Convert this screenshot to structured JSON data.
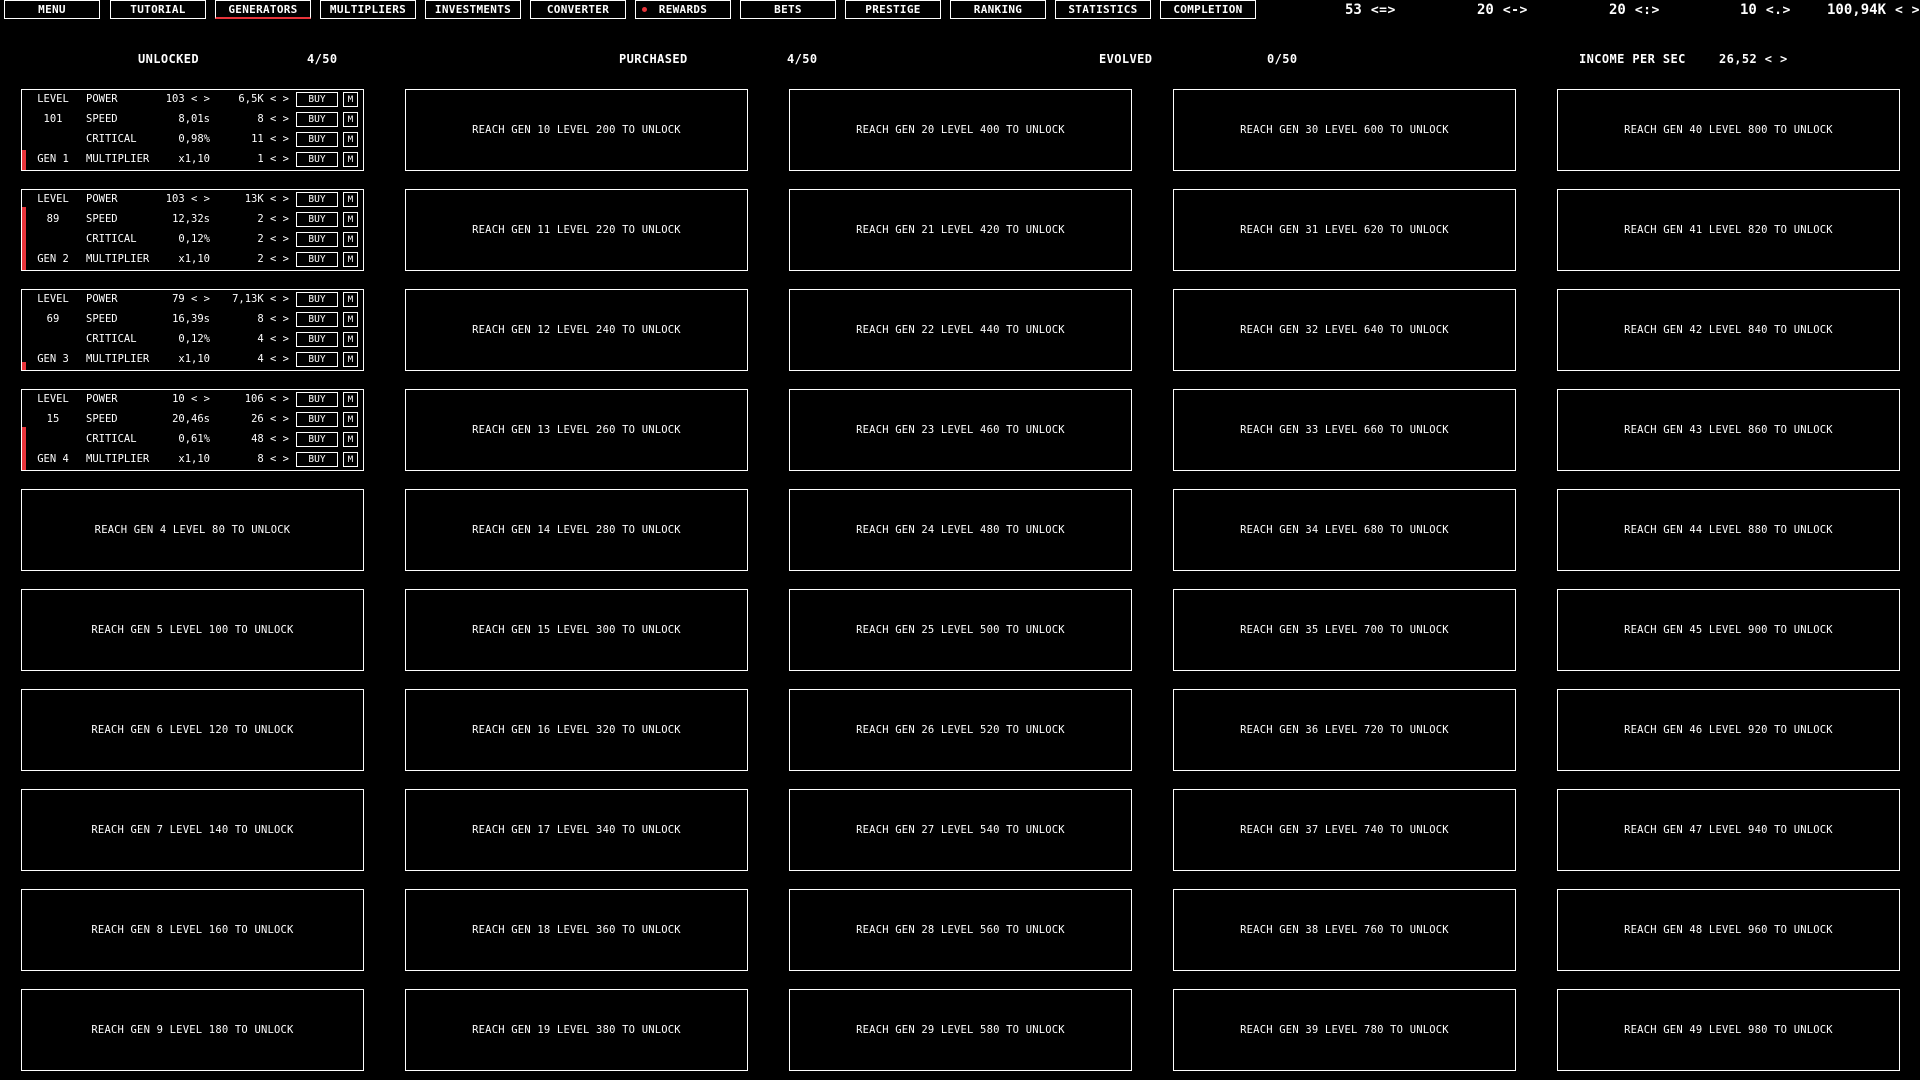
{
  "nav": {
    "tabs": [
      {
        "label": "MENU"
      },
      {
        "label": "TUTORIAL"
      },
      {
        "label": "GENERATORS",
        "active": true
      },
      {
        "label": "MULTIPLIERS"
      },
      {
        "label": "INVESTMENTS"
      },
      {
        "label": "CONVERTER"
      },
      {
        "label": "REWARDS",
        "notification": true
      },
      {
        "label": "BETS"
      },
      {
        "label": "PRESTIGE"
      },
      {
        "label": "RANKING"
      },
      {
        "label": "STATISTICS"
      },
      {
        "label": "COMPLETION"
      }
    ]
  },
  "currencies": [
    {
      "value": "53",
      "symbol": "<=>"
    },
    {
      "value": "20",
      "symbol": "<->"
    },
    {
      "value": "20",
      "symbol": "<:>"
    },
    {
      "value": "10",
      "symbol": "<.>"
    },
    {
      "value": "100,94K",
      "symbol": "< >"
    }
  ],
  "headers": {
    "unlocked": {
      "label": "UNLOCKED",
      "value": "4/50"
    },
    "purchased": {
      "label": "PURCHASED",
      "value": "4/50"
    },
    "evolved": {
      "label": "EVOLVED",
      "value": "0/50"
    },
    "income": {
      "label": "INCOME PER SEC",
      "value": "26,52 < >"
    }
  },
  "labels": {
    "level": "LEVEL",
    "power": "POWER",
    "speed": "SPEED",
    "critical": "CRITICAL",
    "multiplier": "MULTIPLIER",
    "buy": "BUY",
    "max": "M"
  },
  "generators": [
    {
      "level": "101",
      "gen": "GEN 1",
      "progress": 0.25,
      "power": {
        "value": "103 < >",
        "cost": "6,5K < >"
      },
      "speed": {
        "value": "8,01s",
        "cost": "8 < >"
      },
      "critical": {
        "value": "0,98%",
        "cost": "11 < >"
      },
      "multiplier": {
        "value": "x1,10",
        "cost": "1 < >"
      }
    },
    {
      "level": "89",
      "gen": "GEN 2",
      "progress": 0.8,
      "power": {
        "value": "103 < >",
        "cost": "13K < >"
      },
      "speed": {
        "value": "12,32s",
        "cost": "2 < >"
      },
      "critical": {
        "value": "0,12%",
        "cost": "2 < >"
      },
      "multiplier": {
        "value": "x1,10",
        "cost": "2 < >"
      }
    },
    {
      "level": "69",
      "gen": "GEN 3",
      "progress": 0.1,
      "power": {
        "value": "79 < >",
        "cost": "7,13K < >"
      },
      "speed": {
        "value": "16,39s",
        "cost": "8 < >"
      },
      "critical": {
        "value": "0,12%",
        "cost": "4 < >"
      },
      "multiplier": {
        "value": "x1,10",
        "cost": "4 < >"
      }
    },
    {
      "level": "15",
      "gen": "GEN 4",
      "progress": 0.55,
      "power": {
        "value": "10 < >",
        "cost": "106 < >"
      },
      "speed": {
        "value": "20,46s",
        "cost": "26 < >"
      },
      "critical": {
        "value": "0,61%",
        "cost": "48 < >"
      },
      "multiplier": {
        "value": "x1,10",
        "cost": "8 < >"
      }
    }
  ],
  "locked": [
    "REACH GEN 4 LEVEL 80 TO UNLOCK",
    "REACH GEN 5 LEVEL 100 TO UNLOCK",
    "REACH GEN 6 LEVEL 120 TO UNLOCK",
    "REACH GEN 7 LEVEL 140 TO UNLOCK",
    "REACH GEN 8 LEVEL 160 TO UNLOCK",
    "REACH GEN 9 LEVEL 180 TO UNLOCK",
    "REACH GEN 10 LEVEL 200 TO UNLOCK",
    "REACH GEN 11 LEVEL 220 TO UNLOCK",
    "REACH GEN 12 LEVEL 240 TO UNLOCK",
    "REACH GEN 13 LEVEL 260 TO UNLOCK",
    "REACH GEN 14 LEVEL 280 TO UNLOCK",
    "REACH GEN 15 LEVEL 300 TO UNLOCK",
    "REACH GEN 16 LEVEL 320 TO UNLOCK",
    "REACH GEN 17 LEVEL 340 TO UNLOCK",
    "REACH GEN 18 LEVEL 360 TO UNLOCK",
    "REACH GEN 19 LEVEL 380 TO UNLOCK",
    "REACH GEN 20 LEVEL 400 TO UNLOCK",
    "REACH GEN 21 LEVEL 420 TO UNLOCK",
    "REACH GEN 22 LEVEL 440 TO UNLOCK",
    "REACH GEN 23 LEVEL 460 TO UNLOCK",
    "REACH GEN 24 LEVEL 480 TO UNLOCK",
    "REACH GEN 25 LEVEL 500 TO UNLOCK",
    "REACH GEN 26 LEVEL 520 TO UNLOCK",
    "REACH GEN 27 LEVEL 540 TO UNLOCK",
    "REACH GEN 28 LEVEL 560 TO UNLOCK",
    "REACH GEN 29 LEVEL 580 TO UNLOCK",
    "REACH GEN 30 LEVEL 600 TO UNLOCK",
    "REACH GEN 31 LEVEL 620 TO UNLOCK",
    "REACH GEN 32 LEVEL 640 TO UNLOCK",
    "REACH GEN 33 LEVEL 660 TO UNLOCK",
    "REACH GEN 34 LEVEL 680 TO UNLOCK",
    "REACH GEN 35 LEVEL 700 TO UNLOCK",
    "REACH GEN 36 LEVEL 720 TO UNLOCK",
    "REACH GEN 37 LEVEL 740 TO UNLOCK",
    "REACH GEN 38 LEVEL 760 TO UNLOCK",
    "REACH GEN 39 LEVEL 780 TO UNLOCK",
    "REACH GEN 40 LEVEL 800 TO UNLOCK",
    "REACH GEN 41 LEVEL 820 TO UNLOCK",
    "REACH GEN 42 LEVEL 840 TO UNLOCK",
    "REACH GEN 43 LEVEL 860 TO UNLOCK",
    "REACH GEN 44 LEVEL 880 TO UNLOCK",
    "REACH GEN 45 LEVEL 900 TO UNLOCK",
    "REACH GEN 46 LEVEL 920 TO UNLOCK",
    "REACH GEN 47 LEVEL 940 TO UNLOCK",
    "REACH GEN 48 LEVEL 960 TO UNLOCK",
    "REACH GEN 49 LEVEL 980 TO UNLOCK"
  ],
  "colors": {
    "background": "#000000",
    "foreground": "#ffffff",
    "accent": "#e8343a"
  }
}
